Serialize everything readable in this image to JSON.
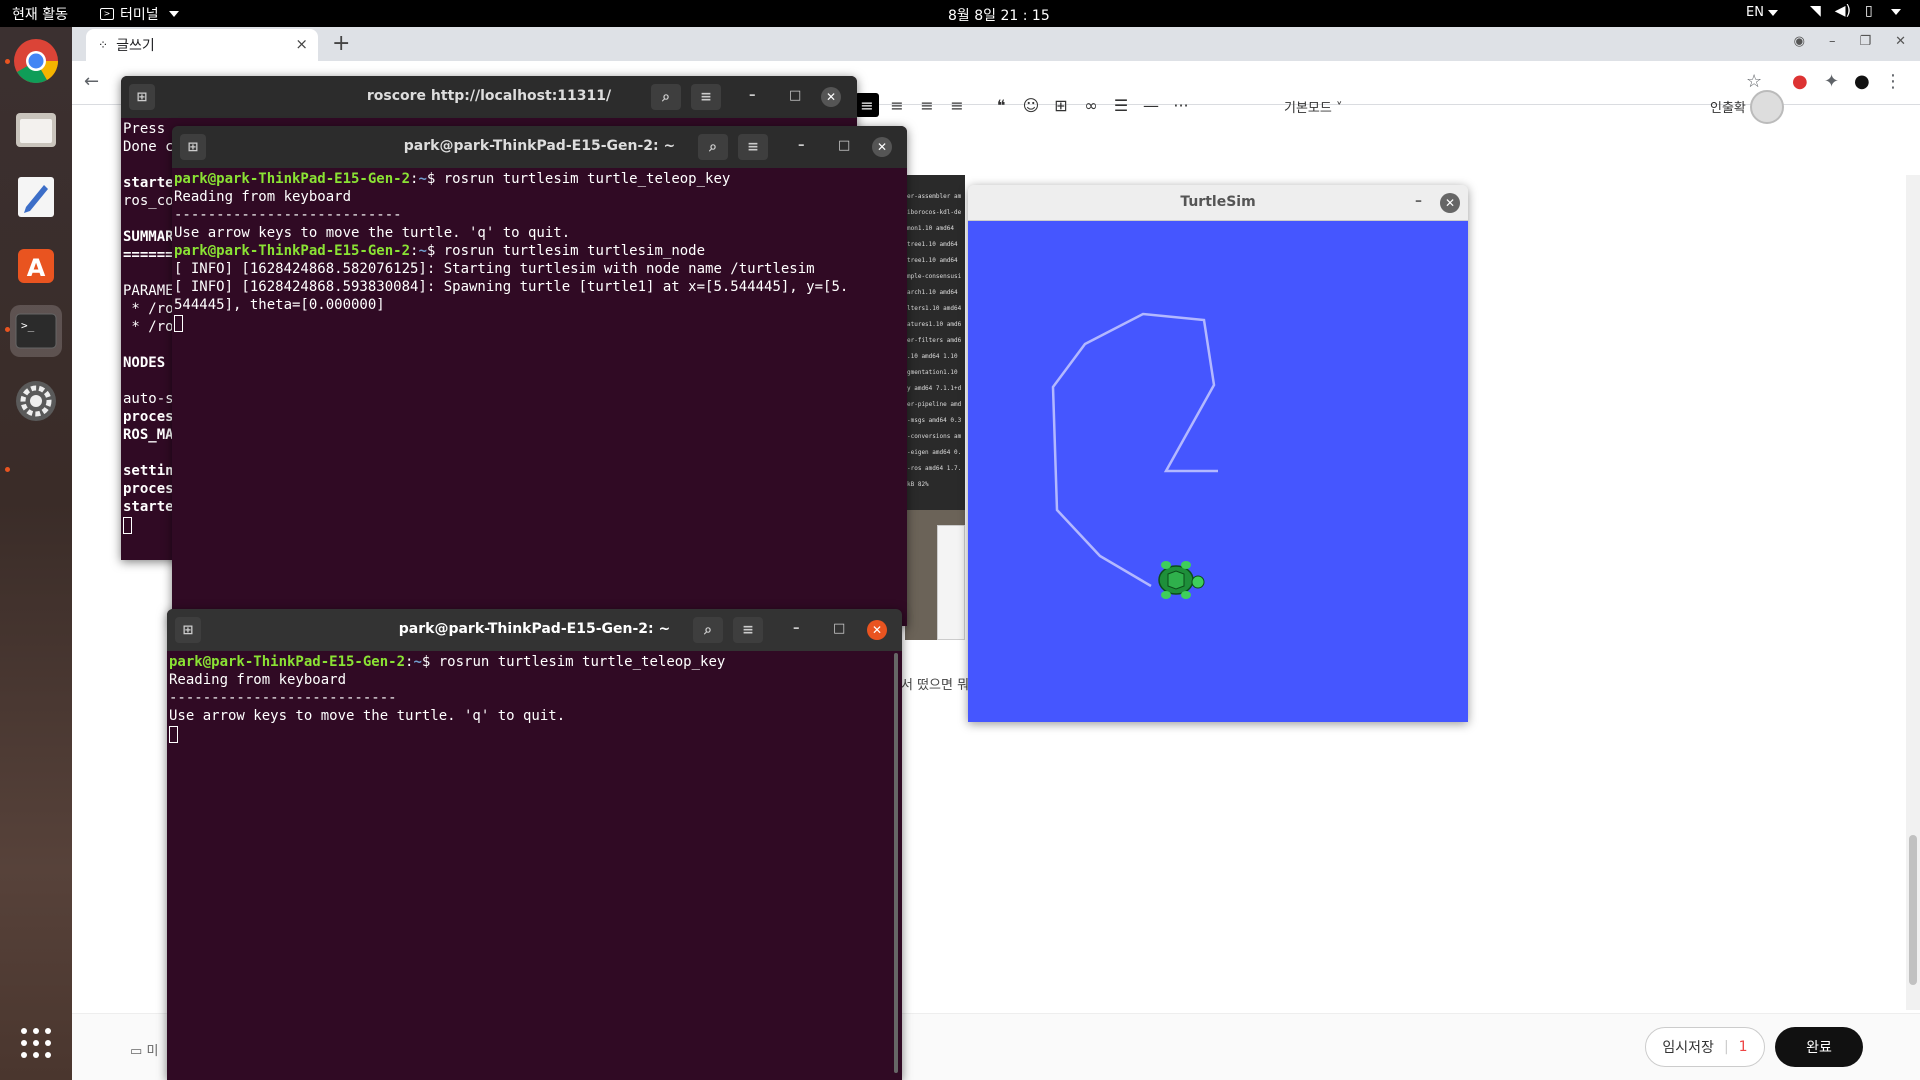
{
  "topbar": {
    "activities": "현재 활동",
    "app_menu": "터미널",
    "clock": "8월 8일 21 : 15",
    "lang": "EN"
  },
  "chrome": {
    "tab_title": "글쓰기",
    "new_tab": "+",
    "tab_close": "×"
  },
  "editor": {
    "mode_select": "기본모드",
    "author": "인출확",
    "snippet": "서 떴으면 뭐",
    "bottom_left": "미",
    "draft_label": "임시저장",
    "draft_count": "1",
    "done_label": "완료",
    "toolbar_items": [
      "align-left",
      "align-center",
      "align-right",
      "align-justify",
      "quote",
      "emoji",
      "table",
      "link",
      "list",
      "divider",
      "more"
    ]
  },
  "bg_shot_lines": [
    "er-assembler am",
    "iborocos-kdl-de",
    "mon1.10 amd64",
    "tree1.10 amd64",
    "tree1.10 amd64",
    "mple-consensusi",
    "arch1.10 amd64",
    "lters1.10 amd64",
    "atures1.10 amd6",
    "er-filters amd6",
    ".10 amd64 1.10",
    "gmentation1.10",
    "y amd64 7.1.1+d",
    "er-pipeline amd",
    "-msgs amd64 0.3",
    "-conversions am",
    "-eigen amd64 0.",
    "-ros amd64 1.7.",
    "kB 82%"
  ],
  "terminals": {
    "roscore": {
      "title": "roscore http://localhost:11311/",
      "lines": [
        "Press",
        "Done c",
        "",
        "starte",
        "ros_co",
        "",
        "SUMMAR",
        "======",
        "",
        "PARAME",
        " * /ro",
        " * /ro",
        "",
        "NODES",
        "",
        "auto-s",
        "proces",
        "ROS_MA",
        "",
        "settin",
        "proces",
        "starte"
      ]
    },
    "middle": {
      "title": "park@park-ThinkPad-E15-Gen-2: ~",
      "user": "park@park-ThinkPad-E15-Gen-2",
      "path": "~",
      "cmd1": "rosrun turtlesim turtle_teleop_key",
      "l2": "Reading from keyboard",
      "l3": "---------------------------",
      "l4": "Use arrow keys to move the turtle. 'q' to quit.",
      "cmd2": "rosrun turtlesim turtlesim_node",
      "l6": "[ INFO] [1628424868.582076125]: Starting turtlesim with node name /turtlesim",
      "l7": "[ INFO] [1628424868.593830084]: Spawning turtle [turtle1] at x=[5.544445], y=[5.",
      "l8": "544445], theta=[0.000000]"
    },
    "front": {
      "title": "park@park-ThinkPad-E15-Gen-2: ~",
      "user": "park@park-ThinkPad-E15-Gen-2",
      "path": "~",
      "cmd1": "rosrun turtlesim turtle_teleop_key",
      "l2": "Reading from keyboard",
      "l3": "---------------------------",
      "l4": "Use arrow keys to move the turtle. 'q' to quit."
    }
  },
  "turtlesim": {
    "title": "TurtleSim",
    "bg_color": "#4556ff",
    "trail_color": "#b3b8ff"
  }
}
